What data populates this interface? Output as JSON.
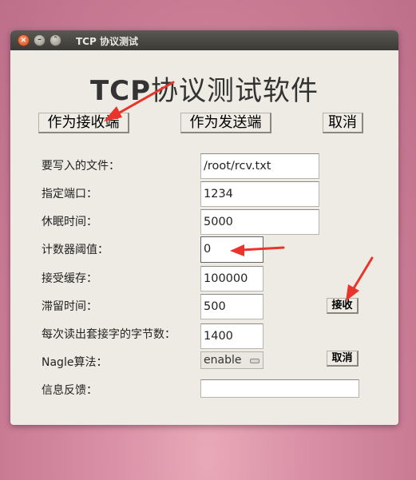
{
  "window": {
    "title": "TCP  协议测试",
    "controls": {
      "close": "×",
      "minimize": "–",
      "maximize": "˄"
    }
  },
  "heading": {
    "bold": "TCP",
    "text": "协议测试软件"
  },
  "top_buttons": {
    "receiver": "作为接收端",
    "sender": "作为发送端",
    "cancel": "取消"
  },
  "form": {
    "file": {
      "label": "要写入的文件：",
      "value": "/root/rcv.txt"
    },
    "port": {
      "label": "指定端口：",
      "value": "1234"
    },
    "sleep": {
      "label": "休眠时间：",
      "value": "5000"
    },
    "threshold": {
      "label": "计数器阈值：",
      "value": "0"
    },
    "buffer": {
      "label": "接受缓存：",
      "value": "100000"
    },
    "linger": {
      "label": "滞留时间：",
      "value": "500"
    },
    "bytes": {
      "label": "每次读出套接字的字节数：",
      "value": "1400"
    },
    "nagle": {
      "label": "Nagle算法：",
      "value": "enable"
    },
    "feedback": {
      "label": "信息反馈：",
      "value": ""
    }
  },
  "side_buttons": {
    "receive": "接收",
    "cancel": "取消"
  },
  "colors": {
    "arrow": "#e8342a",
    "window_bg": "#edebe3",
    "titlebar": "#3b3a36"
  }
}
